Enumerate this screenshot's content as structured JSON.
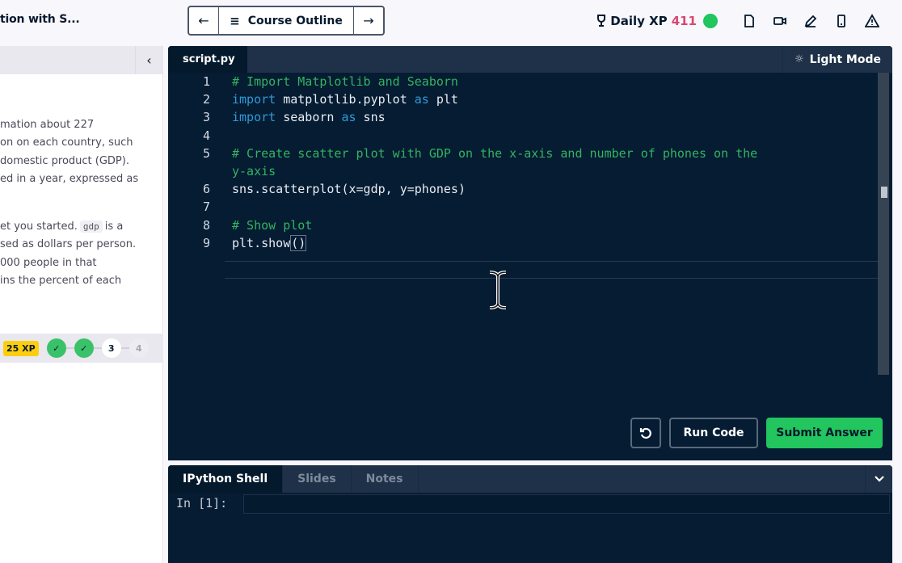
{
  "topbar": {
    "course_title": "tion with S...",
    "nav": {
      "prev_icon": "←",
      "outline_icon": "≡",
      "outline_label": "Course Outline",
      "next_icon": "→"
    },
    "daily_xp_label": "Daily XP",
    "daily_xp_value": "411",
    "icons": [
      "trophy-icon",
      "status-dot",
      "document-icon",
      "video-icon",
      "pencil-icon",
      "mobile-icon",
      "warning-icon"
    ]
  },
  "left_panel": {
    "collapse_icon": "‹",
    "paragraph1": [
      "mation about 227",
      "on on each country, such",
      "domestic product (GDP).",
      "ed in a year, expressed as"
    ],
    "paragraph2": {
      "line1_pre": "et you started.",
      "line1_code": "gdp",
      "line1_post": "is a",
      "lines": [
        "sed as dollars per person.",
        "000 people in that",
        "ins the percent of each"
      ]
    },
    "progress": {
      "xp_badge": "25 XP",
      "steps": [
        {
          "label": "✓",
          "state": "done"
        },
        {
          "label": "✓",
          "state": "done"
        },
        {
          "label": "3",
          "state": "current"
        },
        {
          "label": "4",
          "state": "todo"
        }
      ]
    }
  },
  "editor": {
    "file_tab": "script.py",
    "light_mode_label": "Light Mode",
    "lines": [
      {
        "n": "1",
        "parts": [
          {
            "t": "# Import Matplotlib and Seaborn",
            "c": "comment"
          }
        ]
      },
      {
        "n": "2",
        "parts": [
          {
            "t": "import",
            "c": "kw"
          },
          {
            "t": " matplotlib.pyplot ",
            "c": ""
          },
          {
            "t": "as",
            "c": "kw"
          },
          {
            "t": " plt",
            "c": ""
          }
        ]
      },
      {
        "n": "3",
        "parts": [
          {
            "t": "import",
            "c": "kw"
          },
          {
            "t": " seaborn ",
            "c": ""
          },
          {
            "t": "as",
            "c": "kw"
          },
          {
            "t": " sns",
            "c": ""
          }
        ]
      },
      {
        "n": "4",
        "parts": []
      },
      {
        "n": "5",
        "parts": [
          {
            "t": "# Create scatter plot with GDP on the x-axis and number of phones on the",
            "c": "comment"
          }
        ]
      },
      {
        "n": "",
        "parts": [
          {
            "t": "y-axis",
            "c": "comment"
          }
        ]
      },
      {
        "n": "6",
        "parts": [
          {
            "t": "sns.scatterplot(x=gdp, y=phones)",
            "c": ""
          }
        ]
      },
      {
        "n": "7",
        "parts": []
      },
      {
        "n": "8",
        "parts": [
          {
            "t": "# Show plot",
            "c": "comment"
          }
        ]
      },
      {
        "n": "9",
        "parts": [
          {
            "t": "plt.show",
            "c": ""
          },
          {
            "t": "()",
            "c": "bracket"
          }
        ]
      }
    ],
    "buttons": {
      "reset_icon": "↺",
      "run": "Run Code",
      "submit": "Submit Answer"
    }
  },
  "shell": {
    "tabs": [
      {
        "label": "IPython Shell",
        "active": true
      },
      {
        "label": "Slides",
        "active": false
      },
      {
        "label": "Notes",
        "active": false
      }
    ],
    "prompt": "In [1]:",
    "input_value": "",
    "collapse_icon": "⌄"
  },
  "colors": {
    "accent_green": "#22c55e",
    "xp_red": "#d8476f",
    "editor_bg": "#051c33",
    "xp_badge_yellow": "#fcce0d"
  }
}
